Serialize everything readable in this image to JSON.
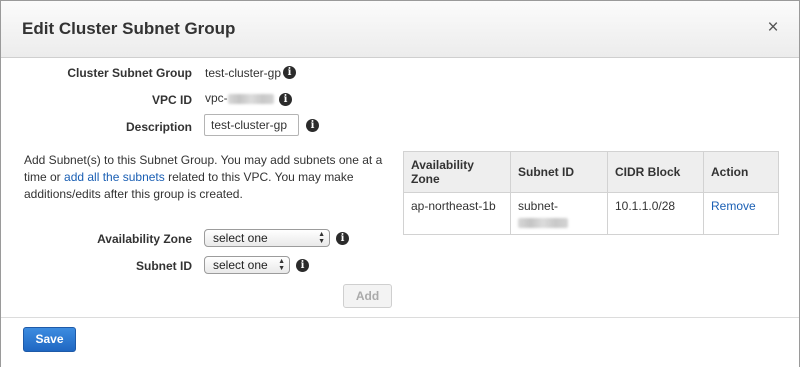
{
  "dialog": {
    "title": "Edit Cluster Subnet Group",
    "close_glyph": "×"
  },
  "form": {
    "cluster_subnet_group_label": "Cluster Subnet Group",
    "cluster_subnet_group_value": "test-cluster-gp",
    "vpc_id_label": "VPC ID",
    "vpc_id_prefix": "vpc-",
    "description_label": "Description",
    "description_value": "test-cluster-gp",
    "info_glyph": "i"
  },
  "add_subnet_text": {
    "before": "Add Subnet(s) to this Subnet Group. You may add subnets one at a time or ",
    "link": "add all the subnets",
    "after": " related to this VPC. You may make additions/edits after this group is created."
  },
  "subnets_table": {
    "columns": [
      "Availability Zone",
      "Subnet ID",
      "CIDR Block",
      "Action"
    ],
    "rows": [
      {
        "availability_zone": "ap-northeast-1b",
        "subnet_id_prefix": "subnet-",
        "cidr_block": "10.1.1.0/28",
        "action": "Remove"
      }
    ]
  },
  "selectors": {
    "availability_zone_label": "Availability Zone",
    "availability_zone_value": "select one",
    "subnet_id_label": "Subnet ID",
    "subnet_id_value": "select one",
    "add_label": "Add"
  },
  "footer": {
    "save_label": "Save"
  },
  "colors": {
    "primary_button": "#2a73d0",
    "link": "#1a5fb4"
  },
  "icons": {
    "close": "close-icon",
    "info": "info-icon",
    "select_arrows": "chevron-up-down-icon"
  }
}
